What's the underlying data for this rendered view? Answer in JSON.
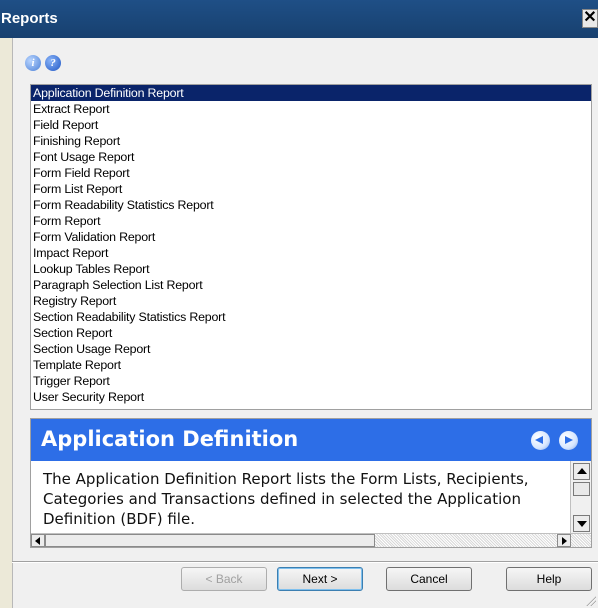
{
  "window": {
    "title": "Reports",
    "close_label": "✕"
  },
  "toolbar": {
    "info_icon": "i",
    "help_icon": "?"
  },
  "reports": [
    "Application Definition Report",
    "Extract Report",
    "Field Report",
    "Finishing Report",
    "Font Usage Report",
    "Form Field Report",
    "Form List Report",
    "Form Readability Statistics Report",
    "Form Report",
    "Form Validation Report",
    "Impact Report",
    "Lookup Tables Report",
    "Paragraph Selection List Report",
    "Registry Report",
    "Section Readability Statistics Report",
    "Section Report",
    "Section Usage Report",
    "Template Report",
    "Trigger Report",
    "User Security Report"
  ],
  "selected_report": "Application Definition Report",
  "description": {
    "title": "Application Definition",
    "text": "The Application Definition Report lists the Form Lists, Recipients, Categories and Transactions defined in selected the Application Definition (BDF) file."
  },
  "buttons": {
    "back": "< Back",
    "next": "Next >",
    "cancel": "Cancel",
    "help": "Help"
  },
  "colors": {
    "title_bar": "#1f4f86",
    "selection": "#0a246a",
    "description_header": "#2d6ee7"
  }
}
